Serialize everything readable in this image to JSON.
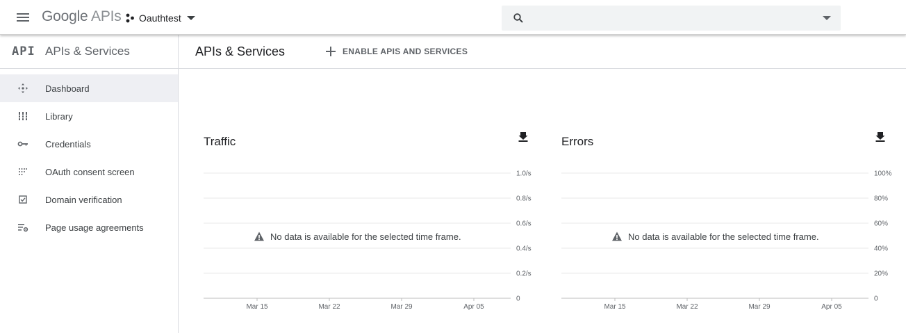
{
  "topbar": {
    "brand_google": "Google",
    "brand_apis": "APIs",
    "project_name": "Oauthtest",
    "search_placeholder": ""
  },
  "sidebar": {
    "logo": "API",
    "title": "APIs & Services",
    "items": [
      {
        "label": "Dashboard",
        "icon": "dashboard-icon",
        "active": true
      },
      {
        "label": "Library",
        "icon": "library-icon",
        "active": false
      },
      {
        "label": "Credentials",
        "icon": "key-icon",
        "active": false
      },
      {
        "label": "OAuth consent screen",
        "icon": "consent-icon",
        "active": false
      },
      {
        "label": "Domain verification",
        "icon": "checkbox-icon",
        "active": false
      },
      {
        "label": "Page usage agreements",
        "icon": "settings-list-icon",
        "active": false
      }
    ]
  },
  "main": {
    "title": "APIs & Services",
    "enable_button": "ENABLE APIS AND SERVICES"
  },
  "chart_data": [
    {
      "type": "line",
      "title": "Traffic",
      "x_ticks": [
        "Mar 15",
        "Mar 22",
        "Mar 29",
        "Apr 05"
      ],
      "y_ticks": [
        "0",
        "0.2/s",
        "0.4/s",
        "0.6/s",
        "0.8/s",
        "1.0/s"
      ],
      "ylim": [
        0,
        1.0
      ],
      "series": [],
      "empty_message": "No data is available for the selected time frame."
    },
    {
      "type": "line",
      "title": "Errors",
      "x_ticks": [
        "Mar 15",
        "Mar 22",
        "Mar 29",
        "Apr 05"
      ],
      "y_ticks": [
        "0",
        "20%",
        "40%",
        "60%",
        "80%",
        "100%"
      ],
      "ylim": [
        0,
        100
      ],
      "series": [],
      "empty_message": "No data is available for the selected time frame."
    }
  ],
  "colors": {
    "gridline": "#e8e8e8",
    "axis": "#bdbdbd",
    "active_bg": "#eeeff3",
    "icon": "#5f6368"
  }
}
